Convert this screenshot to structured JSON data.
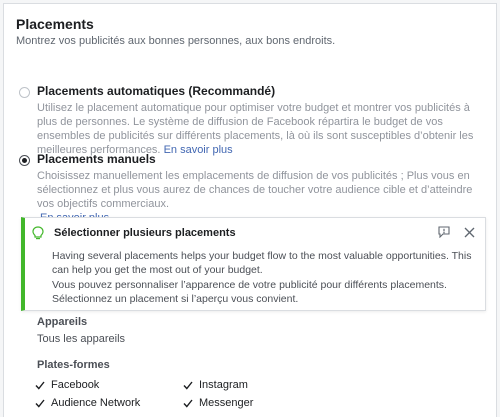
{
  "header": {
    "title": "Placements",
    "subtitle": "Montrez vos publicités aux bonnes personnes, aux bons endroits."
  },
  "options": {
    "automatic": {
      "label": "Placements automatiques (Recommandé)",
      "description": "Utilisez le placement automatique pour optimiser votre budget et montrer vos publicités à plus de personnes. Le système de diffusion de Facebook répartira le budget de vos ensembles de publicités sur différents placements, là où ils sont susceptibles d’obtenir les meilleures performances.",
      "link": "En savoir plus",
      "selected": false
    },
    "manual": {
      "label": "Placements manuels",
      "description": "Choisissez manuellement les emplacements de diffusion de vos publicités ; Plus vous en sélectionnez et plus vous aurez de chances de toucher votre audience cible et d’atteindre vos objectifs commerciaux.",
      "link": "En savoir plus",
      "selected": true
    }
  },
  "info": {
    "title": "Sélectionner plusieurs placements",
    "paragraph1": "Having several placements helps your budget flow to the most valuable opportunities. This can help you get the most out of your budget.",
    "paragraph2": "Vous pouvez personnaliser l’apparence de votre publicité pour différents placements. Sélectionnez un placement si l’aperçu vous convient.",
    "accent": "#42b72a"
  },
  "devices": {
    "label": "Appareils",
    "value": "Tous les appareils"
  },
  "platforms": {
    "label": "Plates-formes",
    "items": [
      {
        "label": "Facebook",
        "checked": true
      },
      {
        "label": "Instagram",
        "checked": true
      },
      {
        "label": "Audience Network",
        "checked": true
      },
      {
        "label": "Messenger",
        "checked": true
      }
    ]
  }
}
